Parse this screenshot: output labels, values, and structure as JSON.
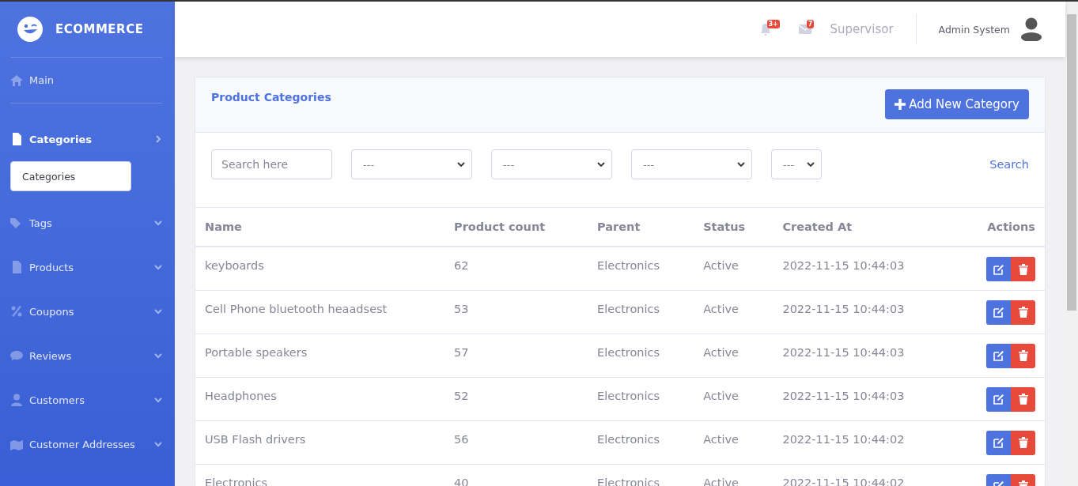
{
  "brand": {
    "name": "ECOMMERCE"
  },
  "sidebar": {
    "items": [
      {
        "kind": "link",
        "label": "Main",
        "active": false
      },
      {
        "kind": "group",
        "label": "Categories",
        "active": true,
        "expanded": true,
        "children": [
          {
            "label": "Categories",
            "selected": true
          }
        ]
      },
      {
        "kind": "group",
        "label": "Tags",
        "active": false,
        "expanded": false
      },
      {
        "kind": "group",
        "label": "Products",
        "active": false,
        "expanded": false
      },
      {
        "kind": "group",
        "label": "Coupons",
        "active": false,
        "expanded": false
      },
      {
        "kind": "group",
        "label": "Reviews",
        "active": false,
        "expanded": false
      },
      {
        "kind": "group",
        "label": "Customers",
        "active": false,
        "expanded": false
      },
      {
        "kind": "group",
        "label": "Customer Addresses",
        "active": false,
        "expanded": false
      }
    ]
  },
  "topbar": {
    "alerts_badge": "3+",
    "messages_badge": "7",
    "role": "Supervisor",
    "user_name": "Admin System"
  },
  "card": {
    "title": "Product Categories",
    "add_button": "Add New Category",
    "filters": {
      "search_placeholder": "Search here",
      "selects": [
        "---",
        "---",
        "---",
        "---"
      ],
      "search_link": "Search"
    },
    "table": {
      "columns": [
        "Name",
        "Product count",
        "Parent",
        "Status",
        "Created At",
        "Actions"
      ],
      "rows": [
        {
          "name": "keyboards",
          "count": "62",
          "parent": "Electronics",
          "status": "Active",
          "created": "2022-11-15 10:44:03"
        },
        {
          "name": "Cell Phone bluetooth heaadsest",
          "count": "53",
          "parent": "Electronics",
          "status": "Active",
          "created": "2022-11-15 10:44:03"
        },
        {
          "name": "Portable speakers",
          "count": "57",
          "parent": "Electronics",
          "status": "Active",
          "created": "2022-11-15 10:44:03"
        },
        {
          "name": "Headphones",
          "count": "52",
          "parent": "Electronics",
          "status": "Active",
          "created": "2022-11-15 10:44:03"
        },
        {
          "name": "USB Flash drivers",
          "count": "56",
          "parent": "Electronics",
          "status": "Active",
          "created": "2022-11-15 10:44:02"
        },
        {
          "name": "Electronics",
          "count": "40",
          "parent": "Electronics",
          "status": "Active",
          "created": "2022-11-15 10:44:02"
        }
      ]
    }
  }
}
